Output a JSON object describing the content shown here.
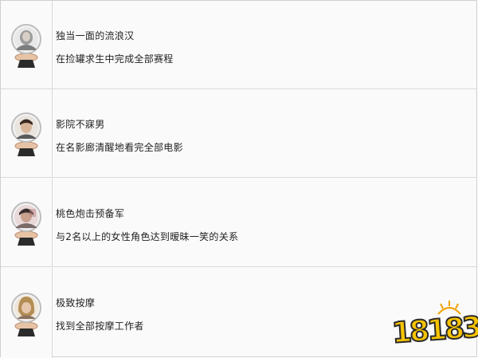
{
  "achievements": [
    {
      "title": "独当一面的流浪汉",
      "description": "在捡罐求生中完成全部赛程",
      "avatar": "gray-hooded-figure"
    },
    {
      "title": "影院不寐男",
      "description": "在名影廊清醒地看完全部电影",
      "avatar": "man-with-dark-hair"
    },
    {
      "title": "桃色炮击预备军",
      "description": "与2名以上的女性角色达到暧昧一笑的关系",
      "avatar": "pink-tinted-man"
    },
    {
      "title": "极致按摩",
      "description": "找到全部按摩工作者",
      "avatar": "woman-with-blonde-hair"
    }
  ],
  "watermark": {
    "text": "18183",
    "color": "#f7c300"
  },
  "colors": {
    "border": "#d9d9d9",
    "background": "#fafafa",
    "text": "#222222",
    "trophy_base": "#2b2b2b",
    "trophy_ring": "#e6c2a6"
  }
}
